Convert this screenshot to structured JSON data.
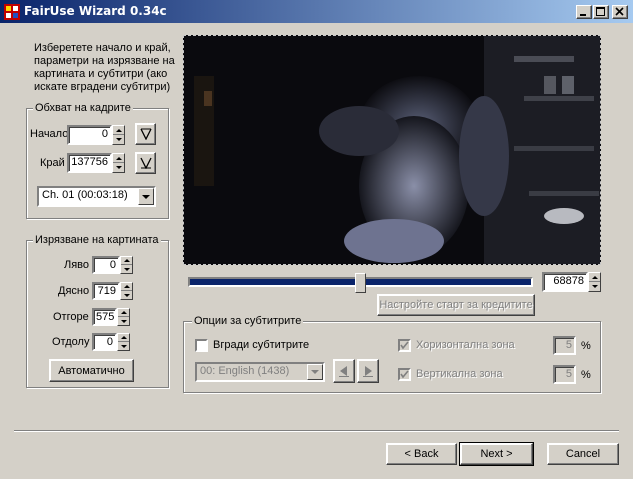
{
  "window": {
    "title": "FairUse Wizard 0.34c"
  },
  "intro": {
    "line1": "Изберетете начало и край,",
    "line2": "параметри на изрязване на",
    "line3": "картината и субтитри (ако",
    "line4": "искате вградени субтитри)"
  },
  "frames": {
    "title": "Обхват на кадрите",
    "start_label": "Начало",
    "start_value": "0",
    "end_label": "Край",
    "end_value": "137756",
    "chapter": "Ch. 01  (00:03:18)"
  },
  "crop": {
    "title": "Изрязване на картината",
    "left_label": "Ляво",
    "left_value": "0",
    "right_label": "Дясно",
    "right_value": "719",
    "top_label": "Отгоре",
    "top_value": "575",
    "bottom_label": "Отдолу",
    "bottom_value": "0",
    "auto_button": "Автоматично"
  },
  "slider": {
    "frame_value": "68878",
    "position": 0.5
  },
  "credits_button": "Настройте старт за кредитите",
  "subs": {
    "title": "Опции за субтитрите",
    "embed_label": "Вгради субтитрите",
    "track": "00: English (1438)",
    "horiz_label": "Хоризонтална зона",
    "horiz_value": "5",
    "horiz_unit": "%",
    "vert_label": "Вертикална зона",
    "vert_value": "5",
    "vert_unit": "%"
  },
  "nav": {
    "back": "< Back",
    "next": "Next >",
    "cancel": "Cancel"
  },
  "colors": {
    "title_start": "#0a246a",
    "title_end": "#a6caf0",
    "face": "#d4d0c8",
    "slider_fill": "#0a246a"
  }
}
